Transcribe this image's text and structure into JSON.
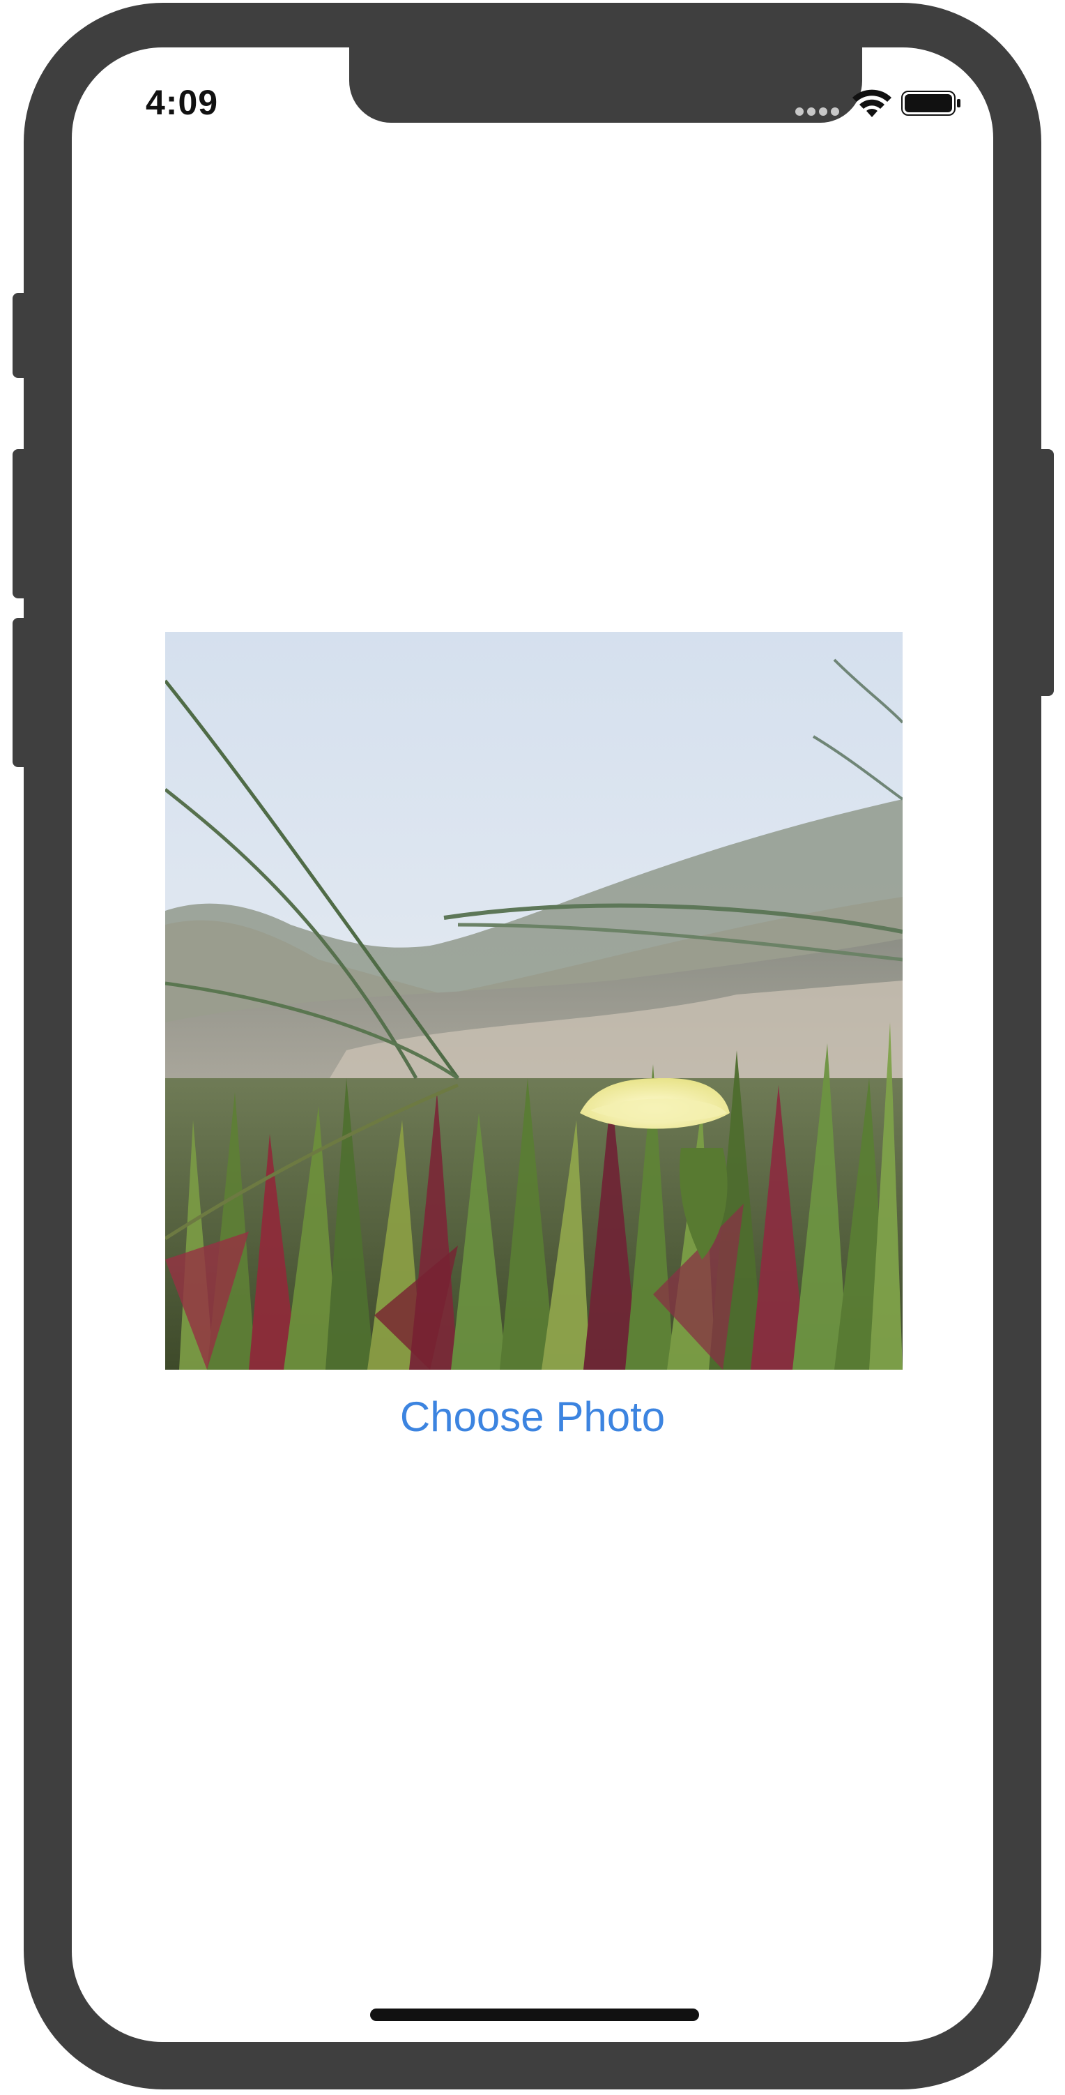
{
  "status_bar": {
    "time": "4:09",
    "icons": [
      "signal-dots-icon",
      "wifi-icon",
      "battery-icon"
    ]
  },
  "main": {
    "photo": {
      "subject": "Yellow ice plant flower among green and red succulent leaves on a sandy dune with grass blades"
    },
    "choose_button_label": "Choose Photo"
  },
  "colors": {
    "accent": "#3c84e0",
    "frame": "#3f3f3f",
    "background": "#ffffff"
  }
}
